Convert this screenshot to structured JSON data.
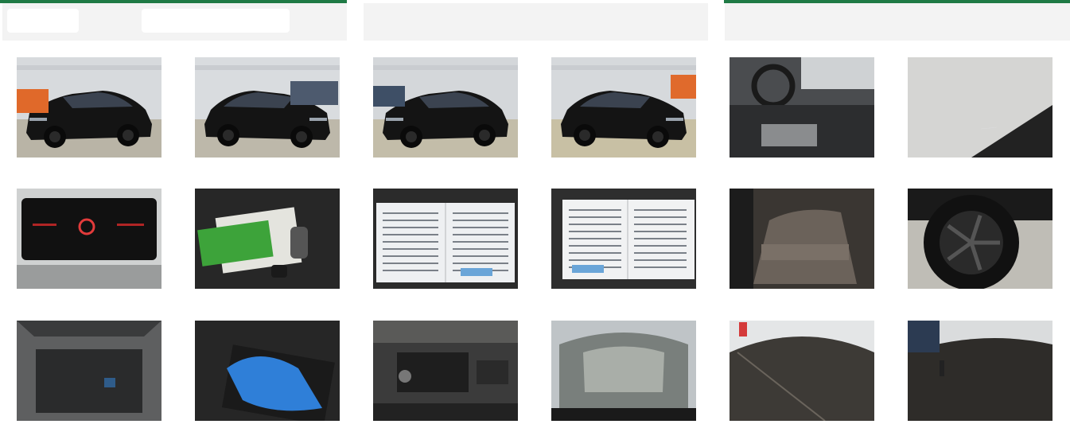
{
  "title": "",
  "colors": {
    "accent_bar": "#1f7a45",
    "panel_header": "#f3f3f3"
  },
  "photos": [
    {
      "subject": "front-left",
      "icon": "car-exterior"
    },
    {
      "subject": "front-right",
      "icon": "car-exterior"
    },
    {
      "subject": "rear-left",
      "icon": "car-exterior"
    },
    {
      "subject": "rear-right",
      "icon": "car-exterior"
    },
    {
      "subject": "interior-dashboard",
      "icon": "car-interior"
    },
    {
      "subject": "floor-mat-label",
      "icon": "car-interior"
    },
    {
      "subject": "instrument-cluster",
      "icon": "car-interior"
    },
    {
      "subject": "keys-and-manual",
      "icon": "documents"
    },
    {
      "subject": "service-book-1",
      "icon": "documents"
    },
    {
      "subject": "service-book-2",
      "icon": "documents"
    },
    {
      "subject": "rear-seats",
      "icon": "car-interior"
    },
    {
      "subject": "wheel",
      "icon": "car-exterior"
    },
    {
      "subject": "trunk",
      "icon": "car-interior"
    },
    {
      "subject": "trunk-equipment",
      "icon": "car-interior"
    },
    {
      "subject": "engine-bay",
      "icon": "car-exterior"
    },
    {
      "subject": "windshield",
      "icon": "car-exterior"
    },
    {
      "subject": "roof-1",
      "icon": "car-exterior"
    },
    {
      "subject": "roof-2",
      "icon": "car-exterior"
    }
  ]
}
